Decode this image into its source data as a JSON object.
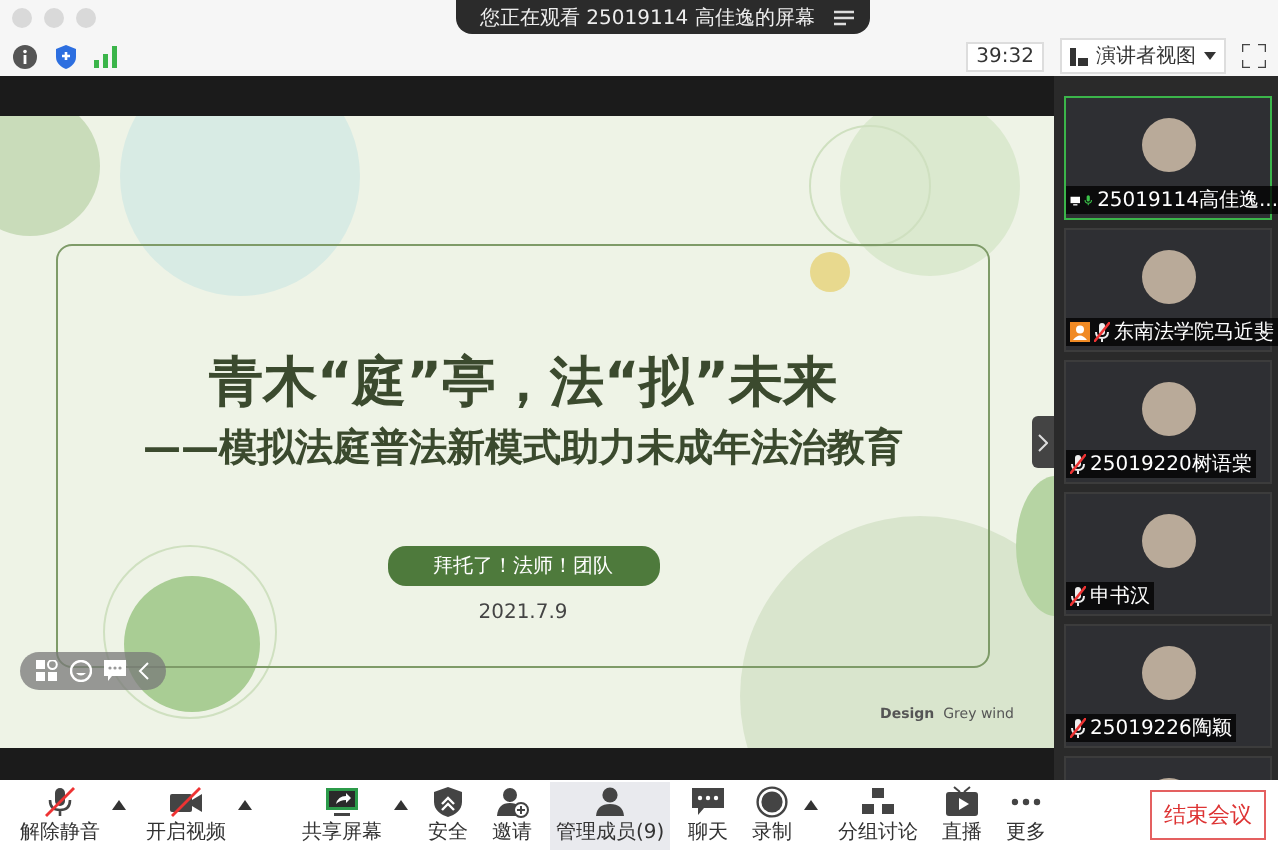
{
  "banner": {
    "text": "您正在观看 25019114 高佳逸的屏幕"
  },
  "topbar": {
    "timer": "39:32",
    "view_button": "演讲者视图"
  },
  "slide": {
    "title": "青木“庭”亭，法“拟”未来",
    "subtitle": "——模拟法庭普法新模式助力未成年法治教育",
    "team": "拜托了！法师！团队",
    "date": "2021.7.9",
    "credit_bold": "Design",
    "credit": "Grey wind"
  },
  "participants": [
    {
      "name": "25019114高佳逸...",
      "muted": false,
      "active": true,
      "sharing": true,
      "host": false
    },
    {
      "name": "东南法学院马近斐",
      "muted": true,
      "active": false,
      "sharing": false,
      "host": true
    },
    {
      "name": "25019220树语棠",
      "muted": true,
      "active": false,
      "sharing": false,
      "host": false
    },
    {
      "name": "申书汉",
      "muted": true,
      "active": false,
      "sharing": false,
      "host": false
    },
    {
      "name": "25019226陶颖",
      "muted": true,
      "active": false,
      "sharing": false,
      "host": false
    }
  ],
  "toolbar": [
    {
      "kind": "mic",
      "label": "解除静音",
      "caret": true,
      "off": true,
      "selected": false
    },
    {
      "kind": "video",
      "label": "开启视频",
      "caret": true,
      "off": true,
      "selected": false
    },
    {
      "kind": "share",
      "label": "共享屏幕",
      "caret": true,
      "off": false,
      "selected": false
    },
    {
      "kind": "security",
      "label": "安全",
      "caret": false,
      "off": false,
      "selected": false
    },
    {
      "kind": "invite",
      "label": "邀请",
      "caret": false,
      "off": false,
      "selected": false
    },
    {
      "kind": "members",
      "label": "管理成员(9)",
      "caret": false,
      "off": false,
      "selected": true
    },
    {
      "kind": "chat",
      "label": "聊天",
      "caret": false,
      "off": false,
      "selected": false
    },
    {
      "kind": "record",
      "label": "录制",
      "caret": true,
      "off": false,
      "selected": false
    },
    {
      "kind": "breakout",
      "label": "分组讨论",
      "caret": false,
      "off": false,
      "selected": false
    },
    {
      "kind": "live",
      "label": "直播",
      "caret": false,
      "off": false,
      "selected": false
    },
    {
      "kind": "more",
      "label": "更多",
      "caret": false,
      "off": false,
      "selected": false
    }
  ],
  "end_button": "结束会议"
}
